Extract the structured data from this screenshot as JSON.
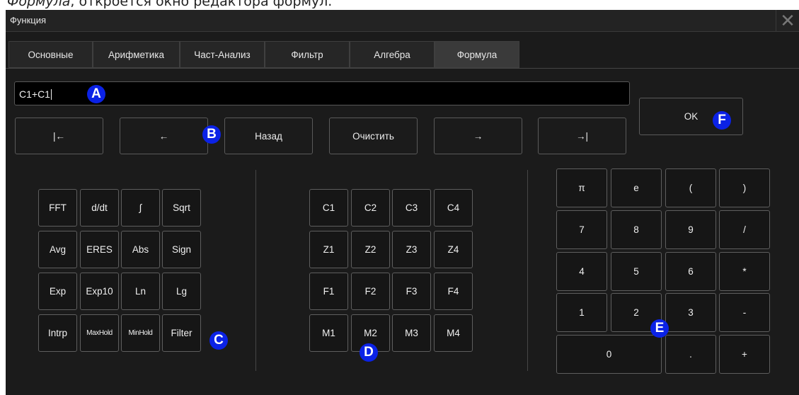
{
  "caption": {
    "italic": "Формула",
    "rest": ", откроется окно редактора формул."
  },
  "dialog": {
    "title": "Функция",
    "close_glyph": "✕"
  },
  "tabs": [
    "Основные",
    "Арифметика",
    "Част-Анализ",
    "Фильтр",
    "Алгебра",
    "Формула"
  ],
  "active_tab": "Формула",
  "formula_input": {
    "value": "C1+C1"
  },
  "edit_buttons": [
    "|←",
    "←",
    "Назад",
    "Очистить",
    "→",
    "→|"
  ],
  "ok_label": "OK",
  "function_keys": [
    [
      "FFT",
      "d/dt",
      "∫",
      "Sqrt"
    ],
    [
      "Avg",
      "ERES",
      "Abs",
      "Sign"
    ],
    [
      "Exp",
      "Exp10",
      "Ln",
      "Lg"
    ],
    [
      "Intrp",
      "MaxHold",
      "MinHold",
      "Filter"
    ]
  ],
  "source_keys": [
    [
      "C1",
      "C2",
      "C3",
      "C4"
    ],
    [
      "Z1",
      "Z2",
      "Z3",
      "Z4"
    ],
    [
      "F1",
      "F2",
      "F3",
      "F4"
    ],
    [
      "M1",
      "M2",
      "M3",
      "M4"
    ]
  ],
  "numpad_keys": [
    [
      "π",
      "e",
      "(",
      ")"
    ],
    [
      "7",
      "8",
      "9",
      "/"
    ],
    [
      "4",
      "5",
      "6",
      "*"
    ],
    [
      "1",
      "2",
      "3",
      "-"
    ],
    [
      "0",
      ".",
      "+"
    ]
  ],
  "markers": {
    "A": "A",
    "B": "B",
    "C": "C",
    "D": "D",
    "E": "E",
    "F": "F"
  }
}
